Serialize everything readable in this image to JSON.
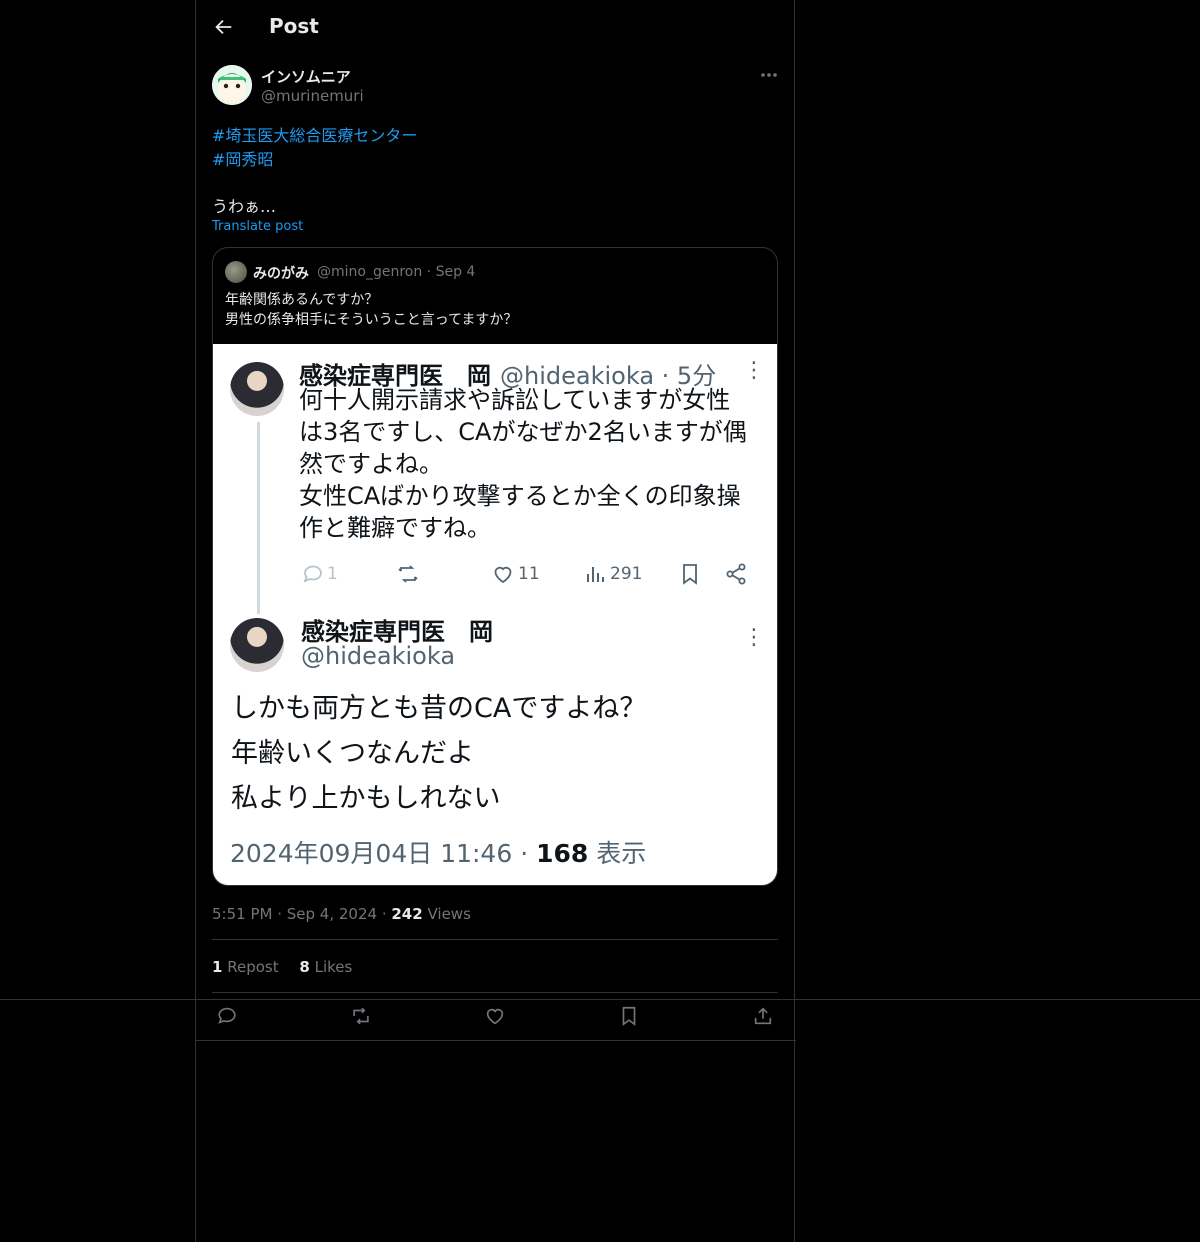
{
  "header": {
    "title": "Post"
  },
  "post": {
    "author_name": "インソムニア",
    "author_handle": "@murinemuri",
    "hashtags": [
      "#埼玉医大総合医療センター",
      "#岡秀昭"
    ],
    "text": "うわぁ…",
    "translate_label": "Translate post",
    "time": "5:51 PM",
    "date": "Sep 4, 2024",
    "views_count": "242",
    "views_label": "Views",
    "reposts_count": "1",
    "reposts_label": "Repost",
    "likes_count": "8",
    "likes_label": "Likes"
  },
  "quote": {
    "name": "みのがみ",
    "handle": "@mino_genron",
    "date": "Sep 4",
    "lines": [
      "年齢関係あるんですか？",
      "男性の係争相手にそういうこと言ってますか？"
    ]
  },
  "screenshot": {
    "tweet1": {
      "name": "感染症専門医　岡",
      "handle": "@hideakioka",
      "time": "5分",
      "lines": [
        "何十人開示請求や訴訟していますが女性",
        "は3名ですし、CAがなぜか2名いますが偶",
        "然ですよね。",
        "女性CAばかり攻撃するとか全くの印象操",
        "作と難癖ですね。"
      ],
      "replies": "1",
      "likes": "11",
      "views": "291"
    },
    "tweet2": {
      "name": "感染症専門医　岡",
      "handle": "@hideakioka",
      "lines": [
        "しかも両方とも昔のCAですよね？",
        "年齢いくつなんだよ",
        "私より上かもしれない"
      ],
      "datetime": "2024年09月04日 11:46",
      "views_count": "168",
      "views_label": "表示"
    }
  },
  "colors": {
    "background": "#000000",
    "text": "#e7e9ea",
    "muted": "#71767b",
    "accent": "#1d9bf0",
    "border": "#2f3336"
  }
}
